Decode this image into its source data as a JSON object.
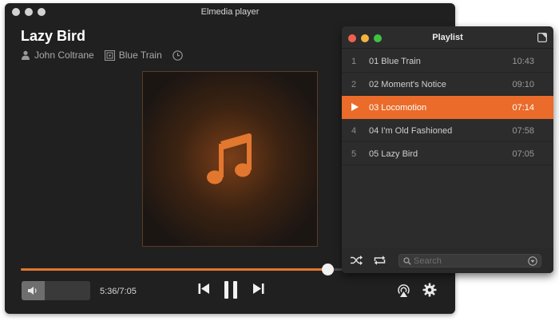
{
  "window": {
    "title": "Elmedia player"
  },
  "now_playing": {
    "title": "Lazy Bird",
    "artist": "John Coltrane",
    "album": "Blue Train"
  },
  "playback": {
    "time_readout": "5:36/7:05",
    "progress": 0.72,
    "volume": 0.34
  },
  "colors": {
    "accent": "#ea6b2a",
    "progress": "#e0772e",
    "window_bg": "#202020",
    "playlist_bg": "#2c2c2c"
  },
  "icons": {
    "artist": "person-icon",
    "album": "album-icon",
    "history": "clock-icon",
    "artwork": "music-note-icon",
    "volume": "speaker-icon",
    "prev": "skip-previous-icon",
    "play": "pause-icon",
    "next": "skip-next-icon",
    "airplay": "airplay-icon",
    "settings": "gear-icon",
    "shuffle": "shuffle-icon",
    "repeat": "repeat-icon",
    "search": "search-icon"
  },
  "playlist": {
    "title": "Playlist",
    "search_placeholder": "Search",
    "tracks": [
      {
        "num": "1",
        "name": "01 Blue Train",
        "duration": "10:43",
        "active": false
      },
      {
        "num": "2",
        "name": "02 Moment's Notice",
        "duration": "09:10",
        "active": false
      },
      {
        "num": "3",
        "name": "03 Locomotion",
        "duration": "07:14",
        "active": true
      },
      {
        "num": "4",
        "name": "04 I'm Old Fashioned",
        "duration": "07:58",
        "active": false
      },
      {
        "num": "5",
        "name": "05 Lazy Bird",
        "duration": "07:05",
        "active": false
      }
    ]
  }
}
